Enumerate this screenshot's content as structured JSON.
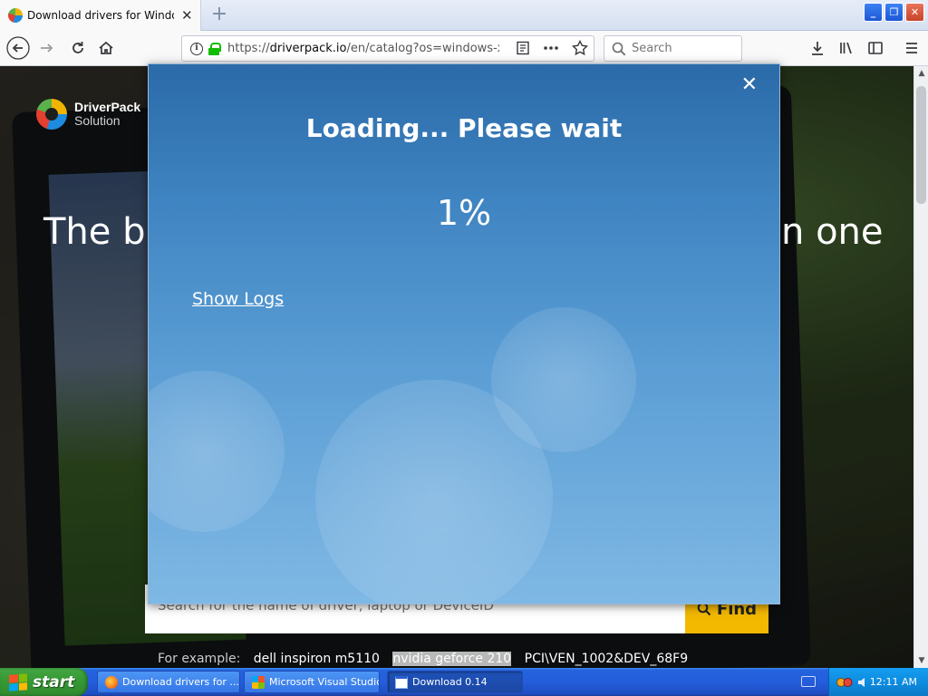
{
  "browser": {
    "tab": {
      "title": "Download drivers for Windows XP",
      "close_glyph": "✕"
    },
    "newtab_glyph": "+",
    "url": {
      "prefix": "https://",
      "host": "driverpack.io",
      "path": "/en/catalog?os=windows-xp"
    },
    "search_placeholder": "Search",
    "window_buttons": {
      "minimize": "_",
      "restore": "❐",
      "close": "✕"
    }
  },
  "site": {
    "logo_name": "DriverPack",
    "logo_sub": "Solution",
    "hero_left": "The big",
    "hero_right": "n one",
    "search_placeholder": "Search for the name of driver, laptop or DeviceID",
    "find_label": "Find",
    "examples_label": "For example:",
    "examples": [
      "dell inspiron m5110",
      "nvidia geforce 210",
      "PCI\\VEN_1002&DEV_68F9"
    ]
  },
  "modal": {
    "close_glyph": "✕",
    "title": "Loading... Please wait",
    "percent": "1%",
    "show_logs": "Show Logs"
  },
  "taskbar": {
    "start_label": "start",
    "tasks": [
      {
        "label": "Download drivers for ..."
      },
      {
        "label": "Microsoft Visual Studio"
      },
      {
        "label": "Download 0.14"
      }
    ],
    "clock": "12:11 AM"
  },
  "colors": {
    "modal_top": "#2b6aa8",
    "modal_bottom": "#7fb8e4",
    "find_button": "#f3b800",
    "taskbar": "#245ddb",
    "start_button": "#379a36",
    "lock_green": "#12bc00"
  },
  "icons": {
    "back": "back-arrow-icon",
    "forward": "forward-arrow-icon",
    "reload": "reload-icon",
    "home": "home-icon",
    "info": "info-icon",
    "lock": "lock-icon",
    "reader": "reader-view-icon",
    "more": "page-actions-icon",
    "bookmark": "bookmark-star-icon",
    "search": "search-icon",
    "download": "download-icon",
    "library": "library-icon",
    "sidebar": "sidebar-icon",
    "menu": "hamburger-menu-icon"
  }
}
